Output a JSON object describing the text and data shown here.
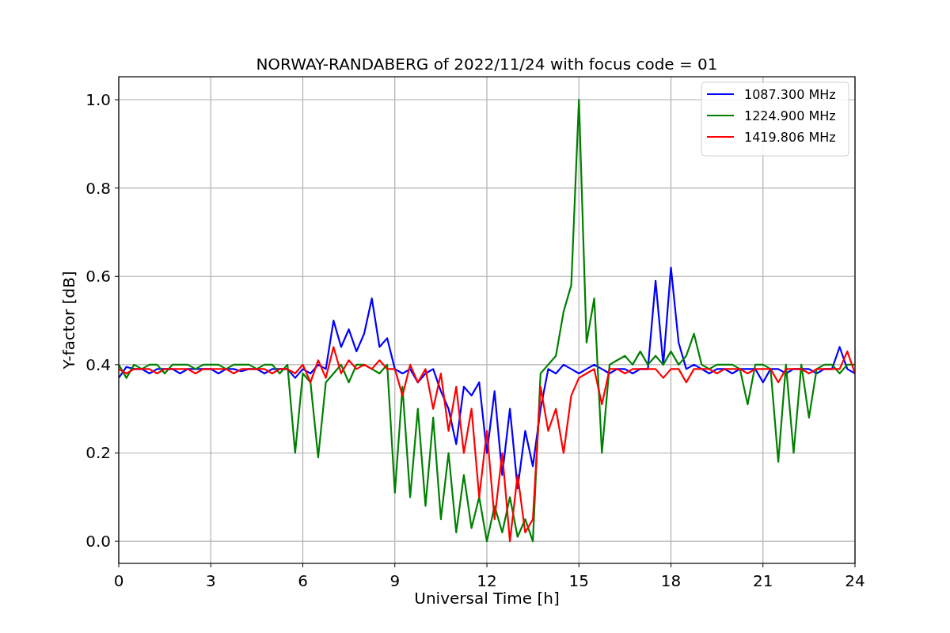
{
  "chart_data": {
    "type": "line",
    "title": "NORWAY-RANDABERG of 2022/11/24 with focus code = 01",
    "xlabel": "Universal Time [h]",
    "ylabel": "Y-factor [dB]",
    "x": [
      0,
      0.25,
      0.5,
      0.75,
      1,
      1.25,
      1.5,
      1.75,
      2,
      2.25,
      2.5,
      2.75,
      3,
      3.25,
      3.5,
      3.75,
      4,
      4.25,
      4.5,
      4.75,
      5,
      5.25,
      5.5,
      5.75,
      6,
      6.25,
      6.5,
      6.75,
      7,
      7.25,
      7.5,
      7.75,
      8,
      8.25,
      8.5,
      8.75,
      9,
      9.25,
      9.5,
      9.75,
      10,
      10.25,
      10.5,
      10.75,
      11,
      11.25,
      11.5,
      11.75,
      12,
      12.25,
      12.5,
      12.75,
      13,
      13.25,
      13.5,
      13.75,
      14,
      14.25,
      14.5,
      14.75,
      15,
      15.25,
      15.5,
      15.75,
      16,
      16.25,
      16.5,
      16.75,
      17,
      17.25,
      17.5,
      17.75,
      18,
      18.25,
      18.5,
      18.75,
      19,
      19.25,
      19.5,
      19.75,
      20,
      20.25,
      20.5,
      20.75,
      21,
      21.25,
      21.5,
      21.75,
      22,
      22.25,
      22.5,
      22.75,
      23,
      23.25,
      23.5,
      23.75,
      24
    ],
    "series": [
      {
        "name": "1087.300 MHz",
        "color": "#0000ff",
        "values": [
          0.37,
          0.395,
          0.39,
          0.39,
          0.38,
          0.39,
          0.39,
          0.39,
          0.38,
          0.39,
          0.39,
          0.39,
          0.39,
          0.38,
          0.39,
          0.39,
          0.385,
          0.39,
          0.39,
          0.38,
          0.39,
          0.39,
          0.39,
          0.37,
          0.39,
          0.38,
          0.4,
          0.39,
          0.5,
          0.44,
          0.48,
          0.43,
          0.47,
          0.55,
          0.44,
          0.46,
          0.39,
          0.38,
          0.39,
          0.36,
          0.38,
          0.39,
          0.34,
          0.3,
          0.22,
          0.35,
          0.33,
          0.36,
          0.2,
          0.34,
          0.15,
          0.3,
          0.12,
          0.25,
          0.17,
          0.3,
          0.39,
          0.38,
          0.4,
          0.39,
          0.38,
          0.39,
          0.4,
          0.39,
          0.38,
          0.39,
          0.39,
          0.38,
          0.39,
          0.39,
          0.59,
          0.4,
          0.62,
          0.45,
          0.39,
          0.4,
          0.39,
          0.38,
          0.39,
          0.39,
          0.38,
          0.39,
          0.39,
          0.39,
          0.36,
          0.39,
          0.39,
          0.38,
          0.39,
          0.39,
          0.39,
          0.38,
          0.39,
          0.39,
          0.44,
          0.39,
          0.38
        ]
      },
      {
        "name": "1224.900 MHz",
        "color": "#008000",
        "values": [
          0.4,
          0.37,
          0.4,
          0.39,
          0.4,
          0.4,
          0.38,
          0.4,
          0.4,
          0.4,
          0.39,
          0.4,
          0.4,
          0.4,
          0.39,
          0.4,
          0.4,
          0.4,
          0.39,
          0.4,
          0.4,
          0.38,
          0.4,
          0.2,
          0.38,
          0.36,
          0.19,
          0.36,
          0.38,
          0.4,
          0.36,
          0.4,
          0.4,
          0.39,
          0.38,
          0.4,
          0.11,
          0.35,
          0.1,
          0.3,
          0.08,
          0.28,
          0.05,
          0.2,
          0.02,
          0.15,
          0.03,
          0.1,
          0.0,
          0.08,
          0.02,
          0.1,
          0.01,
          0.05,
          0.0,
          0.38,
          0.4,
          0.42,
          0.52,
          0.58,
          1.0,
          0.45,
          0.55,
          0.2,
          0.4,
          0.41,
          0.42,
          0.4,
          0.43,
          0.4,
          0.42,
          0.4,
          0.43,
          0.4,
          0.42,
          0.47,
          0.4,
          0.39,
          0.4,
          0.4,
          0.4,
          0.39,
          0.31,
          0.4,
          0.4,
          0.39,
          0.18,
          0.4,
          0.2,
          0.4,
          0.28,
          0.39,
          0.4,
          0.4,
          0.38,
          0.4,
          0.4
        ]
      },
      {
        "name": "1419.806 MHz",
        "color": "#ff0000",
        "values": [
          0.39,
          0.38,
          0.39,
          0.39,
          0.39,
          0.38,
          0.39,
          0.39,
          0.39,
          0.39,
          0.38,
          0.39,
          0.39,
          0.39,
          0.39,
          0.38,
          0.39,
          0.39,
          0.39,
          0.39,
          0.38,
          0.39,
          0.39,
          0.38,
          0.4,
          0.36,
          0.41,
          0.37,
          0.44,
          0.38,
          0.41,
          0.39,
          0.4,
          0.39,
          0.41,
          0.39,
          0.39,
          0.33,
          0.4,
          0.36,
          0.39,
          0.3,
          0.38,
          0.25,
          0.35,
          0.2,
          0.3,
          0.1,
          0.25,
          0.05,
          0.2,
          0.0,
          0.15,
          0.02,
          0.05,
          0.35,
          0.25,
          0.3,
          0.2,
          0.33,
          0.37,
          0.38,
          0.39,
          0.31,
          0.39,
          0.39,
          0.38,
          0.39,
          0.39,
          0.39,
          0.39,
          0.37,
          0.39,
          0.39,
          0.36,
          0.39,
          0.39,
          0.39,
          0.38,
          0.39,
          0.39,
          0.39,
          0.38,
          0.39,
          0.39,
          0.39,
          0.36,
          0.39,
          0.39,
          0.39,
          0.38,
          0.39,
          0.39,
          0.39,
          0.39,
          0.43,
          0.38
        ]
      }
    ],
    "grid": true,
    "legend": true,
    "xlim": [
      0,
      24
    ],
    "ylim": [
      -0.05,
      1.052
    ],
    "xticks": [
      0,
      3,
      6,
      9,
      12,
      15,
      18,
      21,
      24
    ],
    "yticks": [
      {
        "value": 0,
        "label": "0.0"
      },
      {
        "value": 0.2,
        "label": "0.2"
      },
      {
        "value": 0.4,
        "label": "0.4"
      },
      {
        "value": 0.6,
        "label": "0.6"
      },
      {
        "value": 0.8,
        "label": "0.8"
      },
      {
        "value": 1.0,
        "label": "1.0"
      }
    ]
  }
}
